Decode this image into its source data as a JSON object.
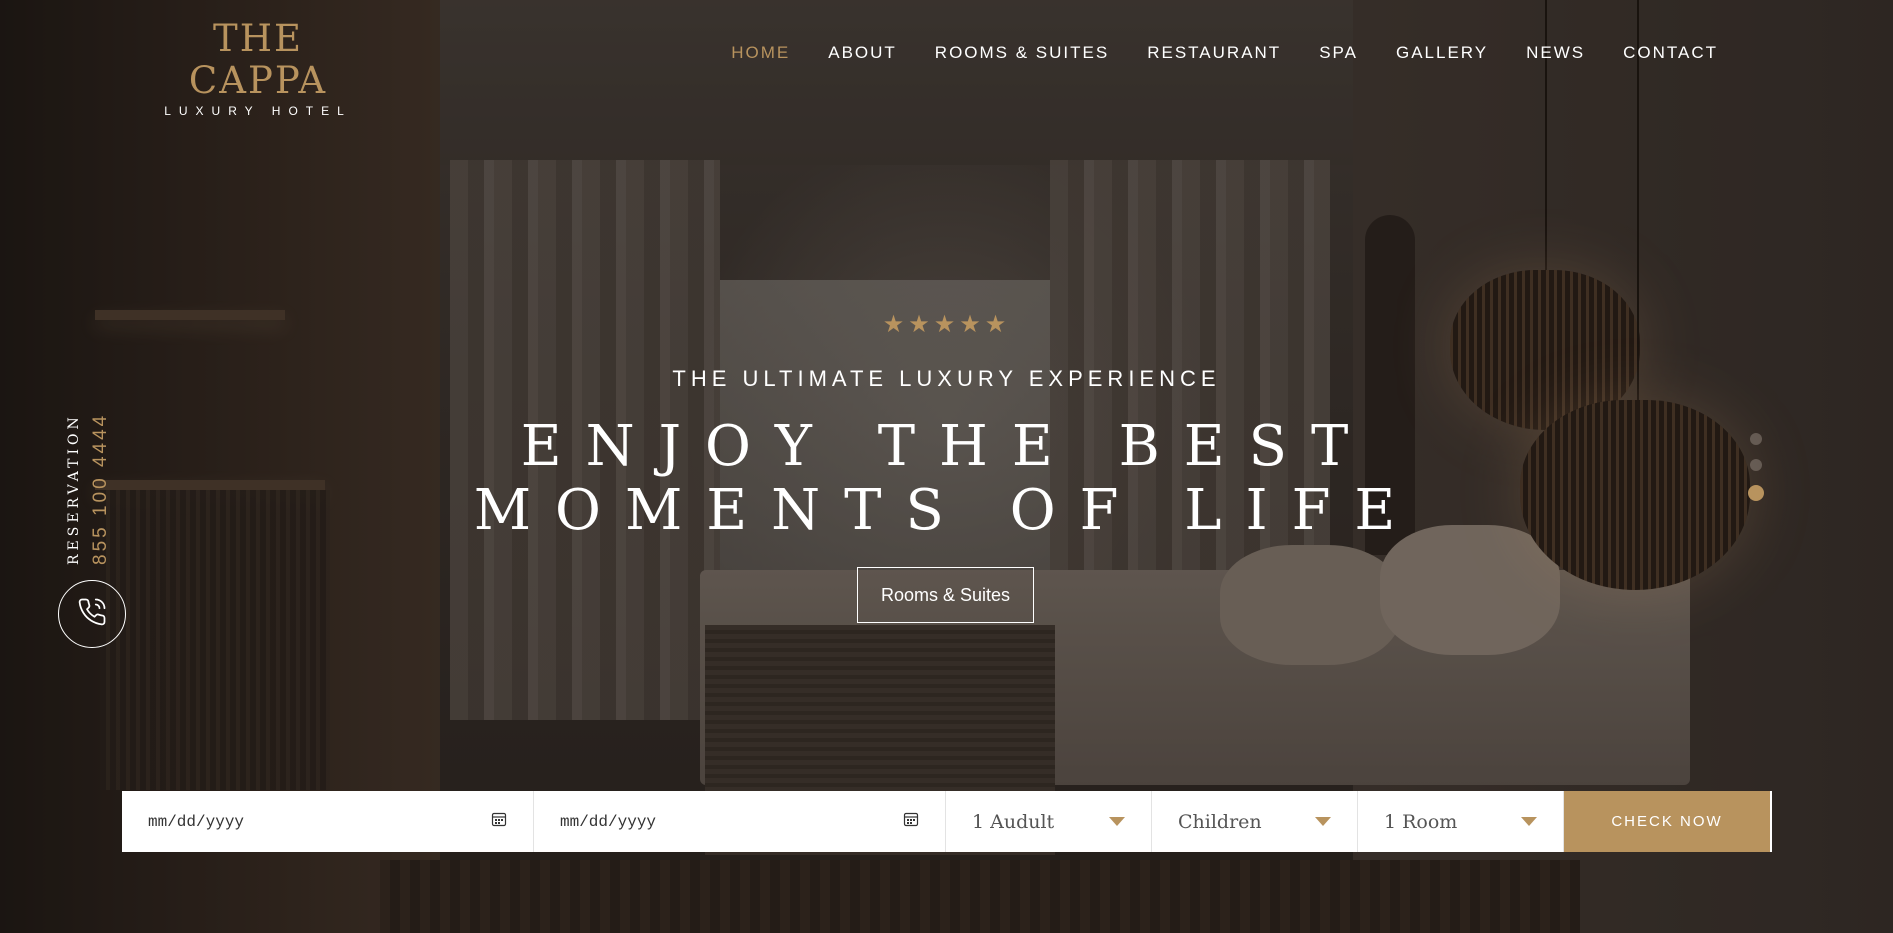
{
  "brand": {
    "title": "THE CAPPA",
    "subtitle": "LUXURY HOTEL"
  },
  "nav": {
    "items": [
      {
        "label": "HOME",
        "active": true
      },
      {
        "label": "ABOUT"
      },
      {
        "label": "ROOMS & SUITES"
      },
      {
        "label": "RESTAURANT"
      },
      {
        "label": "SPA"
      },
      {
        "label": "GALLERY"
      },
      {
        "label": "NEWS"
      },
      {
        "label": "CONTACT"
      }
    ]
  },
  "reservation": {
    "label": "RESERVATION",
    "phone": "855 100 4444",
    "icon": "phone-icon"
  },
  "hero": {
    "stars": "★★★★★",
    "star_rating": 5,
    "tagline": "THE ULTIMATE LUXURY EXPERIENCE",
    "headline_line1": "ENJOY THE BEST",
    "headline_line2": "MOMENTS OF LIFE",
    "cta_label": "Rooms & Suites"
  },
  "slider": {
    "count": 3,
    "active_index": 2
  },
  "booking": {
    "check_in": {
      "placeholder": "mm/dd/yyyy",
      "icon": "calendar-icon"
    },
    "check_out": {
      "placeholder": "mm/dd/yyyy",
      "icon": "calendar-icon"
    },
    "adults": "1 Audult",
    "children": "Children",
    "rooms": "1 Room",
    "submit_label": "CHECK NOW"
  },
  "colors": {
    "accent": "#b8935e",
    "text_light": "#ffffff",
    "booking_bg": "#ffffff"
  }
}
